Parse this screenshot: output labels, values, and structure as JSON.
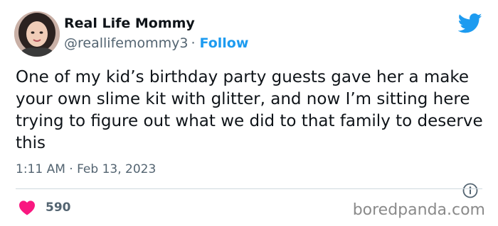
{
  "author": {
    "name": "Real Life Mommy",
    "handle": "@reallifemommy3",
    "separator": "·",
    "follow_label": "Follow"
  },
  "tweet": {
    "text": "One of my kid’s birthday party guests gave her a make your own slime kit with glitter, and now I’m sitting here trying to figure out what we did to that family to deserve this",
    "timestamp": "1:11 AM · Feb 13, 2023"
  },
  "engagement": {
    "like_count": "590"
  },
  "watermark": "boredpanda.com",
  "icons": {
    "brand": "twitter-bird-icon",
    "info": "info-icon",
    "like": "heart-icon"
  },
  "colors": {
    "brand_blue": "#1d9bf0",
    "like_pink": "#f91880",
    "secondary_text": "#536471"
  }
}
